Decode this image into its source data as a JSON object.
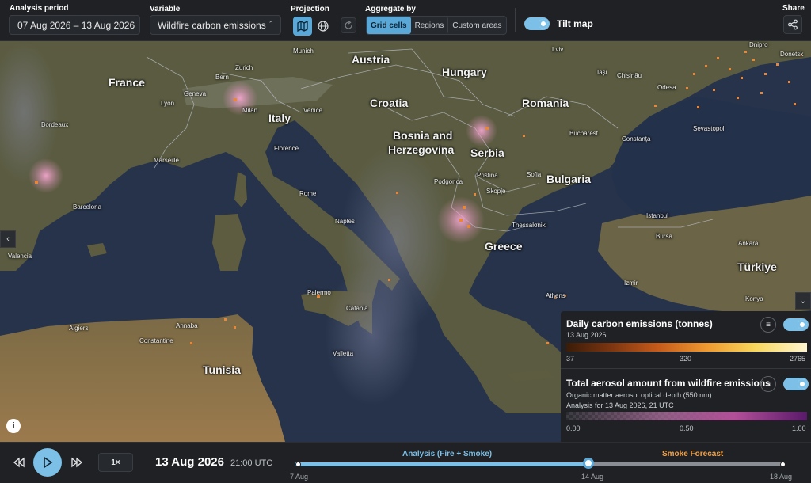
{
  "toolbar": {
    "period_label": "Analysis period",
    "period_value": "07 Aug 2026 – 13 Aug 2026",
    "variable_label": "Variable",
    "variable_value": "Wildfire carbon emissions",
    "projection_label": "Projection",
    "projection_options": [
      {
        "icon": "map-icon",
        "active": true
      },
      {
        "icon": "globe-icon",
        "active": false
      }
    ],
    "aggregate_label": "Aggregate by",
    "aggregate_options": [
      "Grid cells",
      "Regions",
      "Custom areas"
    ],
    "aggregate_selected": "Grid cells",
    "tilt_label": "Tilt map",
    "tilt_on": true,
    "share_label": "Share"
  },
  "map": {
    "countries": [
      "France",
      "Austria",
      "Hungary",
      "Italy",
      "Croatia",
      "Romania",
      "Bosnia and",
      "Herzegovina",
      "Serbia",
      "Bulgaria",
      "Greece",
      "Türkiye",
      "Tunisia"
    ],
    "cities": [
      "Munich",
      "Zurich",
      "Bern",
      "Geneva",
      "Lyon",
      "Milan",
      "Venice",
      "Bordeaux",
      "Florence",
      "Marseille",
      "Rome",
      "Barcelona",
      "Naples",
      "Valencia",
      "Palermo",
      "Catania",
      "Algiers",
      "Annaba",
      "Constantine",
      "Valletta",
      "Lviv",
      "Iași",
      "Chișinău",
      "Odesa",
      "Dnipro",
      "Donetsk",
      "Sevastopol",
      "Bucharest",
      "Constanța",
      "Sofia",
      "Priština",
      "Skopje",
      "Podgorica",
      "Thessaloniki",
      "Istanbul",
      "Bursa",
      "Athens",
      "İzmir",
      "Ankara",
      "Konya"
    ],
    "colors": {
      "sea": "#243042",
      "land": "#57583e",
      "border": "#b8bcc2",
      "fire": "#e8873a",
      "smoke": "#e79ac4"
    }
  },
  "legend": {
    "carbon": {
      "title": "Daily carbon emissions (tonnes)",
      "date": "13 Aug 2026",
      "ticks": [
        "37",
        "320",
        "2765"
      ],
      "enabled": true
    },
    "aerosol": {
      "title": "Total aerosol amount from wildfire emissions",
      "subtitle": "Organic matter aerosol optical depth (550 nm)",
      "analysis": "Analysis for 13 Aug 2026, 21 UTC",
      "ticks": [
        "0.00",
        "0.50",
        "1.00"
      ],
      "enabled": true
    }
  },
  "timeline": {
    "speed": "1×",
    "current_date": "13 Aug 2026",
    "current_time": "21:00 UTC",
    "phase_analysis": "Analysis (Fire + Smoke)",
    "phase_forecast": "Smoke Forecast",
    "start_label": "7 Aug",
    "mid_label": "14 Aug",
    "end_label": "18 Aug",
    "progress": 0.6
  }
}
